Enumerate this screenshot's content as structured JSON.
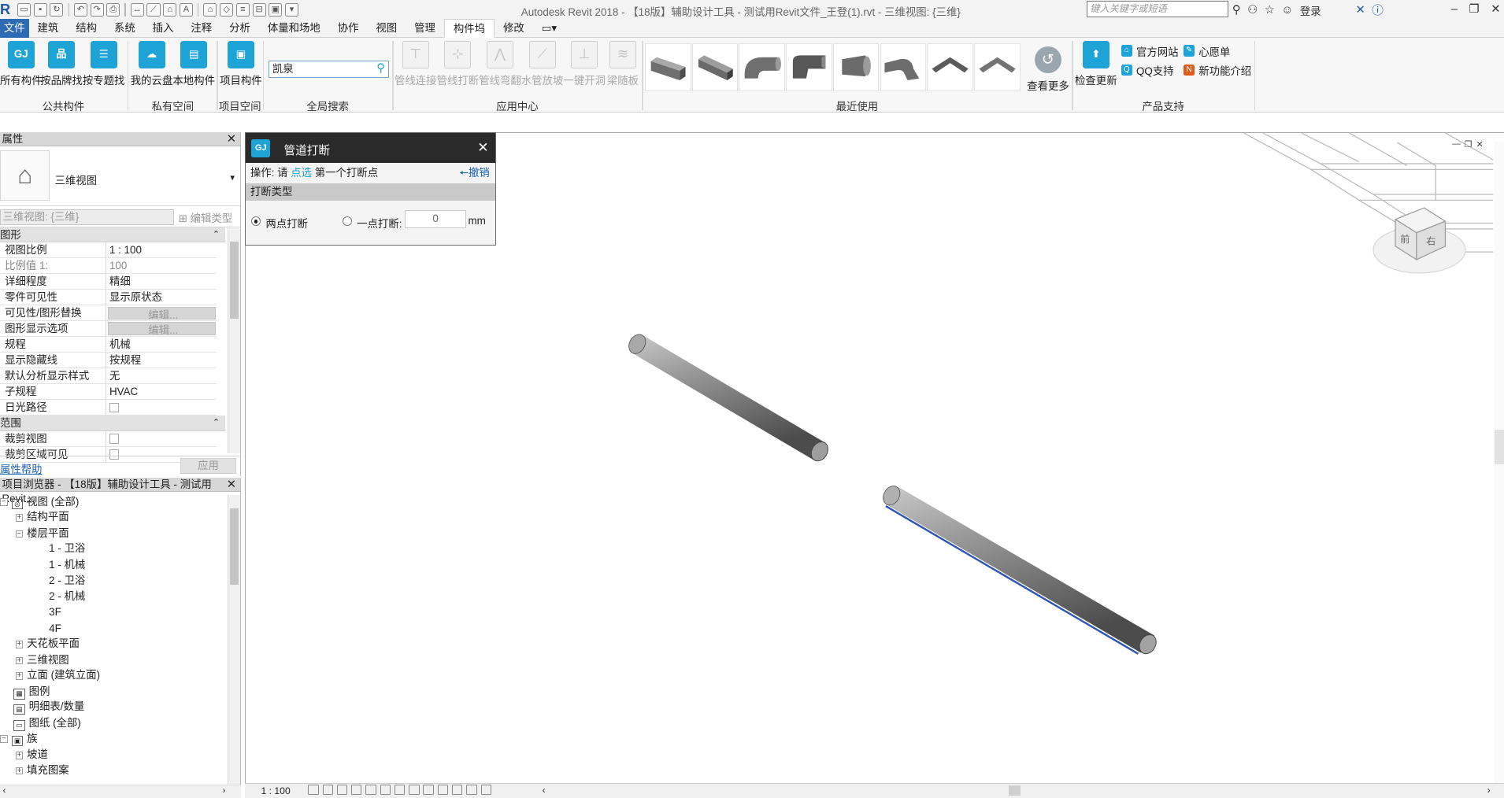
{
  "app_title": "Autodesk Revit 2018 -    【18版】辅助设计工具 - 测试用Revit文件_王登(1).rvt - 三维视图: {三维}",
  "search_placeholder": "键入关键字或短语",
  "login_label": "登录",
  "menu_tabs": [
    "文件",
    "建筑",
    "结构",
    "系统",
    "插入",
    "注释",
    "分析",
    "体量和场地",
    "协作",
    "视图",
    "管理",
    "构件坞",
    "修改"
  ],
  "ribbon": {
    "public": {
      "label": "公共构件",
      "buttons": [
        "所有构件",
        "按品牌找",
        "按专题找"
      ]
    },
    "private": {
      "label": "私有空间",
      "buttons": [
        "我的云盘",
        "本地构件"
      ]
    },
    "project": {
      "label": "项目空间",
      "buttons": [
        "项目构件"
      ]
    },
    "global_search": {
      "label": "全局搜索",
      "value": "凯泉"
    },
    "app_center": {
      "label": "应用中心",
      "buttons": [
        "管线连接",
        "管线打断",
        "管线弯翻",
        "水管放坡",
        "一键开洞",
        "梁随板"
      ]
    },
    "recent": {
      "label": "最近使用",
      "more": "查看更多"
    },
    "support": {
      "label": "产品支持",
      "check_update": "检查更新",
      "links": [
        "官方网站",
        "QQ支持",
        "心愿单",
        "新功能介绍"
      ]
    }
  },
  "properties": {
    "title": "属性",
    "type_name": "三维视图",
    "instance_selector": "三维视图: {三维}",
    "edit_type": "编辑类型",
    "graphics_category": "图形",
    "rows": [
      {
        "k": "视图比例",
        "v": "1 : 100"
      },
      {
        "k": "比例值 1:",
        "v": "100"
      },
      {
        "k": "详细程度",
        "v": "精细"
      },
      {
        "k": "零件可见性",
        "v": "显示原状态"
      },
      {
        "k": "可见性/图形替换",
        "v": "编辑..."
      },
      {
        "k": "图形显示选项",
        "v": "编辑..."
      },
      {
        "k": "规程",
        "v": "机械"
      },
      {
        "k": "显示隐藏线",
        "v": "按规程"
      },
      {
        "k": "默认分析显示样式",
        "v": "无"
      },
      {
        "k": "子规程",
        "v": "HVAC"
      },
      {
        "k": "日光路径",
        "v": ""
      }
    ],
    "extents_category": "范围",
    "extents_rows": [
      {
        "k": "裁剪视图",
        "v": ""
      },
      {
        "k": "裁剪区域可见",
        "v": ""
      }
    ],
    "help_link": "属性帮助",
    "apply": "应用"
  },
  "browser": {
    "title": "项目浏览器 - 【18版】辅助设计工具 - 测试用Revit...",
    "nodes": [
      "视图 (全部)",
      "结构平面",
      "楼层平面",
      "1 - 卫浴",
      "1 - 机械",
      "2 - 卫浴",
      "2 - 机械",
      "3F",
      "4F",
      "天花板平面",
      "三维视图",
      "立面 (建筑立面)",
      "图例",
      "明细表/数量",
      "图纸 (全部)",
      "族",
      "坡道",
      "填充图案"
    ]
  },
  "dialog": {
    "title": "管道打断",
    "op_prefix": "操作: 请",
    "op_highlight": "点选",
    "op_suffix": "第一个打断点",
    "undo": "撤销",
    "section": "打断类型",
    "opt_two": "两点打断",
    "opt_one": "一点打断:",
    "value": "0",
    "unit": "mm",
    "selected": "两点打断"
  },
  "viewcube": {
    "front": "前",
    "right": "右"
  },
  "status": {
    "scale": "1 : 100"
  }
}
